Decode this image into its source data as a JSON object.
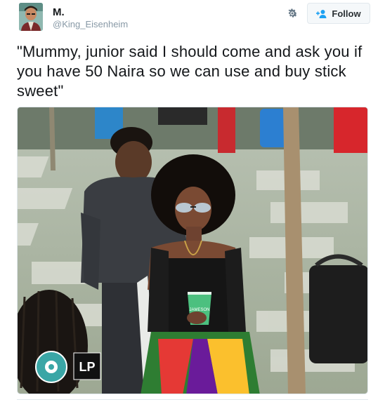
{
  "user": {
    "display_name": "M.",
    "handle": "@King_Eisenheim"
  },
  "actions": {
    "follow_label": "Follow"
  },
  "tweet": {
    "text": "\"Mummy, junior said I should come and ask you if you have 50 Naira so we can use and buy stick sweet\""
  },
  "photo": {
    "cup_text": "JAMESON",
    "watermark_right": "LP"
  },
  "colors": {
    "accent": "#1da1f2",
    "text": "#14171a",
    "muted": "#8899a6"
  },
  "icons": {
    "gear": "gear-icon",
    "follow": "add-user-icon"
  }
}
